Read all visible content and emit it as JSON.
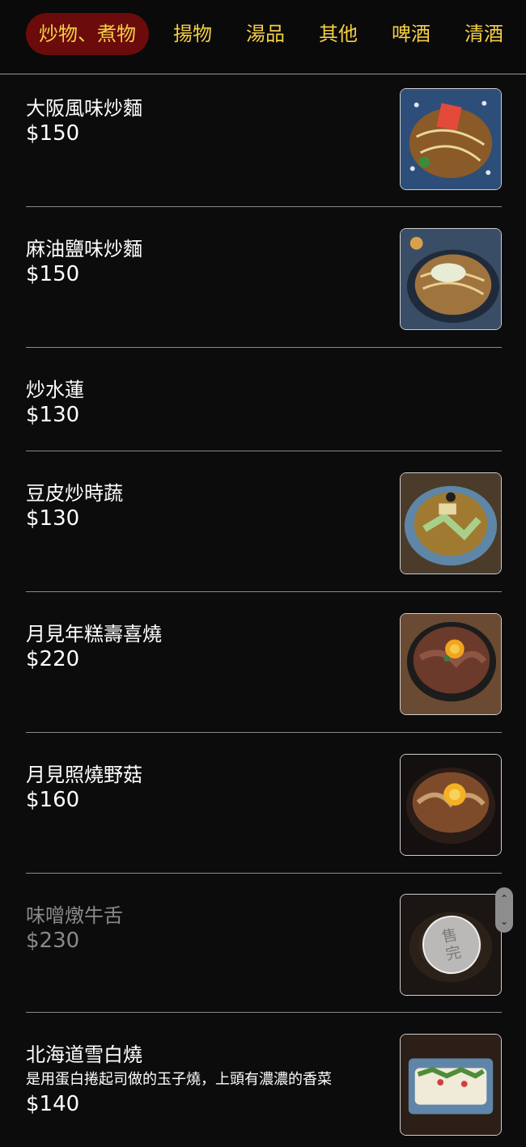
{
  "tabs": [
    {
      "label": "炒物、煮物",
      "active": true
    },
    {
      "label": "揚物",
      "active": false
    },
    {
      "label": "湯品",
      "active": false
    },
    {
      "label": "其他",
      "active": false
    },
    {
      "label": "啤酒",
      "active": false
    },
    {
      "label": "清酒",
      "active": false
    }
  ],
  "items": [
    {
      "name": "大阪風味炒麵",
      "price": "$150",
      "image": "yakisoba-photo"
    },
    {
      "name": "麻油鹽味炒麵",
      "price": "$150",
      "image": "sesame-noodles-photo"
    },
    {
      "name": "炒水蓮",
      "price": "$130"
    },
    {
      "name": "豆皮炒時蔬",
      "price": "$130",
      "image": "tofu-skin-vegetables-photo"
    },
    {
      "name": "月見年糕壽喜燒",
      "price": "$220",
      "image": "sukiyaki-photo"
    },
    {
      "name": "月見照燒野菇",
      "price": "$160",
      "image": "teriyaki-mushroom-photo"
    },
    {
      "name": "味噌燉牛舌",
      "price": "$230",
      "image": "beef-tongue-photo",
      "sold_out": true,
      "sold_out_label": "售完"
    },
    {
      "name": "北海道雪白燒",
      "description": "是用蛋白捲起司做的玉子燒，上頭有濃濃的香菜",
      "price": "$140",
      "image": "tamagoyaki-photo"
    }
  ],
  "scroll_control": {
    "up": "⌃",
    "down": "⌄"
  },
  "colors": {
    "tab_text": "#f3cf45",
    "tab_active_bg": "#6b0b0b",
    "background": "#0c0c0d"
  }
}
